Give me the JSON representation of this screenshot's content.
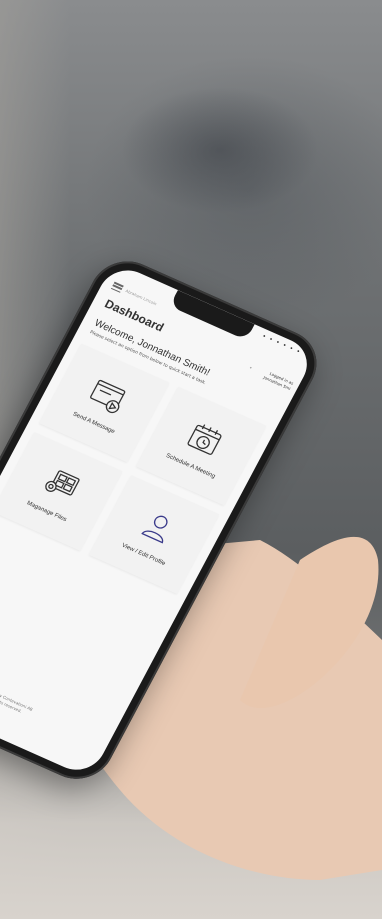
{
  "app": {
    "brand": "Abraham Lincoln",
    "status_text": "• • • • • •",
    "title": "Dashboard",
    "logged_in_label": "Logged in as",
    "user_name": "Jonnathan Smi",
    "welcome": "Welcome, Jonnathan Smith!",
    "instructions": "Please select an option from below to quick start a task.",
    "tiles": [
      {
        "label": "Send A Message",
        "icon": "message-icon"
      },
      {
        "label": "Schedule A Meeting",
        "icon": "calendar-icon"
      },
      {
        "label": "Maganage Files",
        "icon": "files-gear-icon"
      },
      {
        "label": "View / Edit Profile",
        "icon": "profile-icon"
      }
    ],
    "footer_line1": "Created by Contevationi AB",
    "footer_line2": "All rights reserved."
  },
  "colors": {
    "screen_bg": "#f7f7f7",
    "phone_frame": "#1a1a1a",
    "text": "#333333"
  }
}
